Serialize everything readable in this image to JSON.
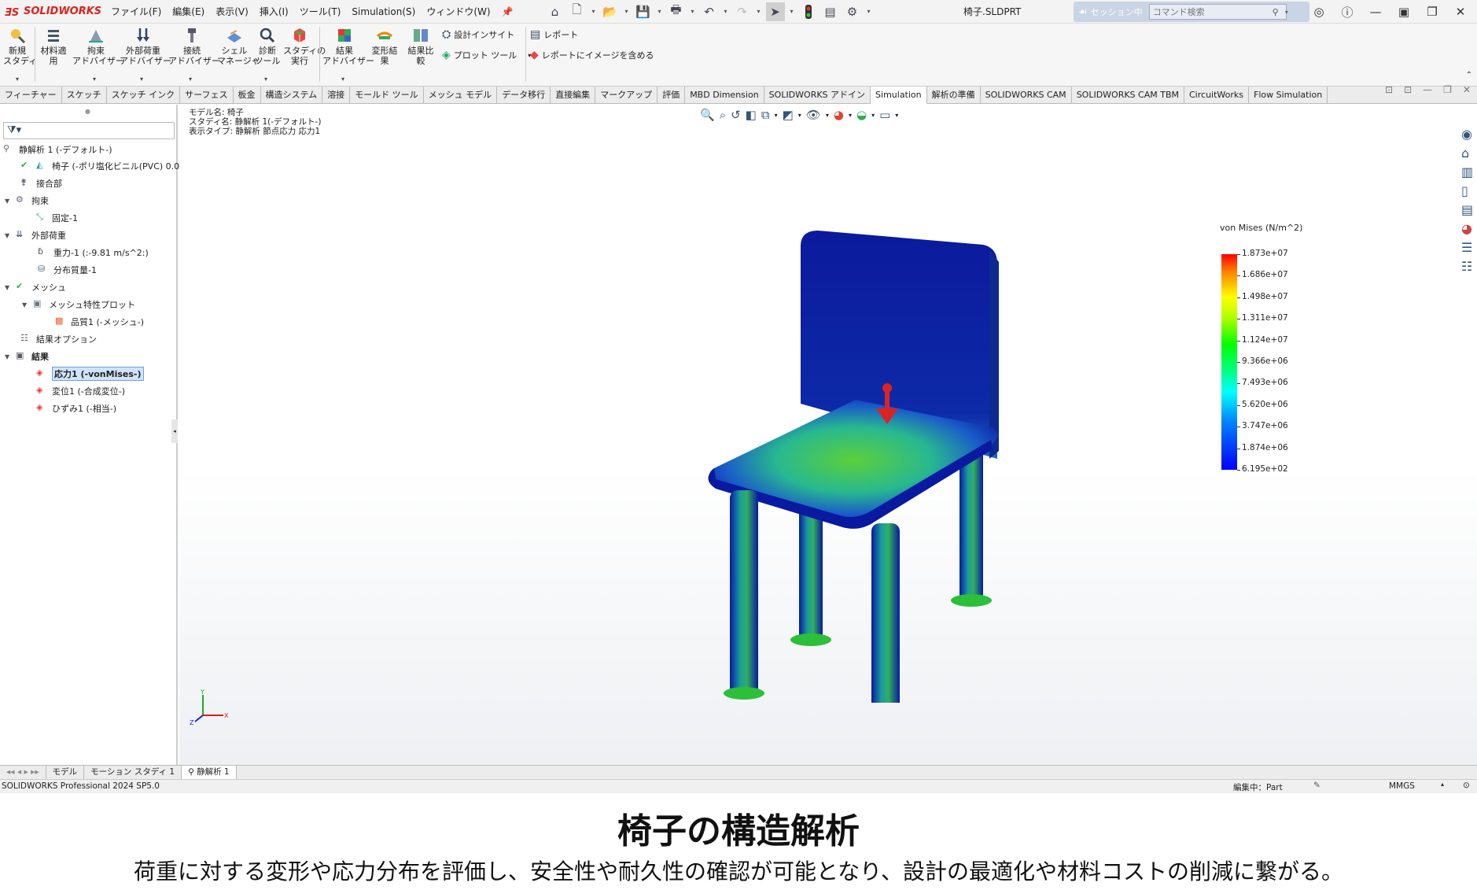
{
  "app": {
    "name": "SOLIDWORKS",
    "doc_title": "椅子.SLDPRT"
  },
  "menu": [
    "ファイル(F)",
    "編集(E)",
    "表示(V)",
    "挿入(I)",
    "ツール(T)",
    "Simulation(S)",
    "ウィンドウ(W)"
  ],
  "search": {
    "session_label": "セッション中",
    "placeholder": "コマンド検索"
  },
  "commands": {
    "new_study": "新規\nスタディ",
    "apply_material": "材料適\n用",
    "fixtures_advisor": "拘束\nアドバイザー",
    "external_loads_advisor": "外部荷重\nアドバイザー",
    "connections_advisor": "接続\nアドバイザー",
    "shell_manager": "シェル\nマネージャ",
    "diagnostic_tools": "診断\nツール",
    "run_study": "スタディの\n実行",
    "results_advisor": "結果\nアドバイザー",
    "deformed_result": "変形結\n果",
    "compare_results": "結果比\n較",
    "design_insight": "設計インサイト",
    "plot_tools": "プロット ツール",
    "report": "レポート",
    "include_image_report": "レポートにイメージを含める"
  },
  "tabs": [
    "フィーチャー",
    "スケッチ",
    "スケッチ インク",
    "サーフェス",
    "板金",
    "構造システム",
    "溶接",
    "モールド ツール",
    "メッシュ モデル",
    "データ移行",
    "直接編集",
    "マークアップ",
    "評価",
    "MBD Dimension",
    "SOLIDWORKS アドイン",
    "Simulation",
    "解析の準備",
    "SOLIDWORKS CAM",
    "SOLIDWORKS CAM TBM",
    "CircuitWorks",
    "Flow Simulation"
  ],
  "active_tab": "Simulation",
  "tree": {
    "root": "静解析 1 (-デフォルト-)",
    "part": "椅子 (-ポリ塩化ビニル(PVC) 0.0",
    "connections": "接合部",
    "fixtures": "拘束",
    "fixed": "固定-1",
    "external_loads": "外部荷重",
    "gravity": "重力-1 (:-9.81 m/s^2:)",
    "distributed_mass": "分布質量-1",
    "mesh": "メッシュ",
    "mesh_plot": "メッシュ特性プロット",
    "quality": "品質1 (-メッシュ-)",
    "result_options": "結果オプション",
    "results": "結果",
    "stress": "応力1 (-vonMises-)",
    "displacement": "変位1 (-合成変位-)",
    "strain": "ひずみ1 (-相当-)"
  },
  "study_info": {
    "model": "モデル名: 椅子",
    "study": "スタディ名: 静解析 1(-デフォルト-)",
    "plot_type": "表示タイプ: 静解析 節点応力 応力1"
  },
  "legend": {
    "title": "von Mises (N/m^2)",
    "labels": [
      "1.873e+07",
      "1.686e+07",
      "1.498e+07",
      "1.311e+07",
      "1.124e+07",
      "9.366e+06",
      "7.493e+06",
      "5.620e+06",
      "3.747e+06",
      "1.874e+06",
      "6.195e+02"
    ]
  },
  "bottom_tabs": [
    "モデル",
    "モーション スタディ 1",
    "静解析 1"
  ],
  "status": {
    "version": "SOLIDWORKS Professional 2024 SP5.0",
    "editing": "編集中：Part",
    "units": "MMGS"
  },
  "caption": {
    "title": "椅子の構造解析",
    "subtitle": "荷重に対する変形や応力分布を評価し、安全性や耐久性の確認が可能となり、設計の最適化や材料コストの削減に繋がる。"
  },
  "colors": {
    "accent_red": "#d22222",
    "selection": "#cfe3fb",
    "legend_max": "#ff0000",
    "legend_min": "#0000ff"
  }
}
